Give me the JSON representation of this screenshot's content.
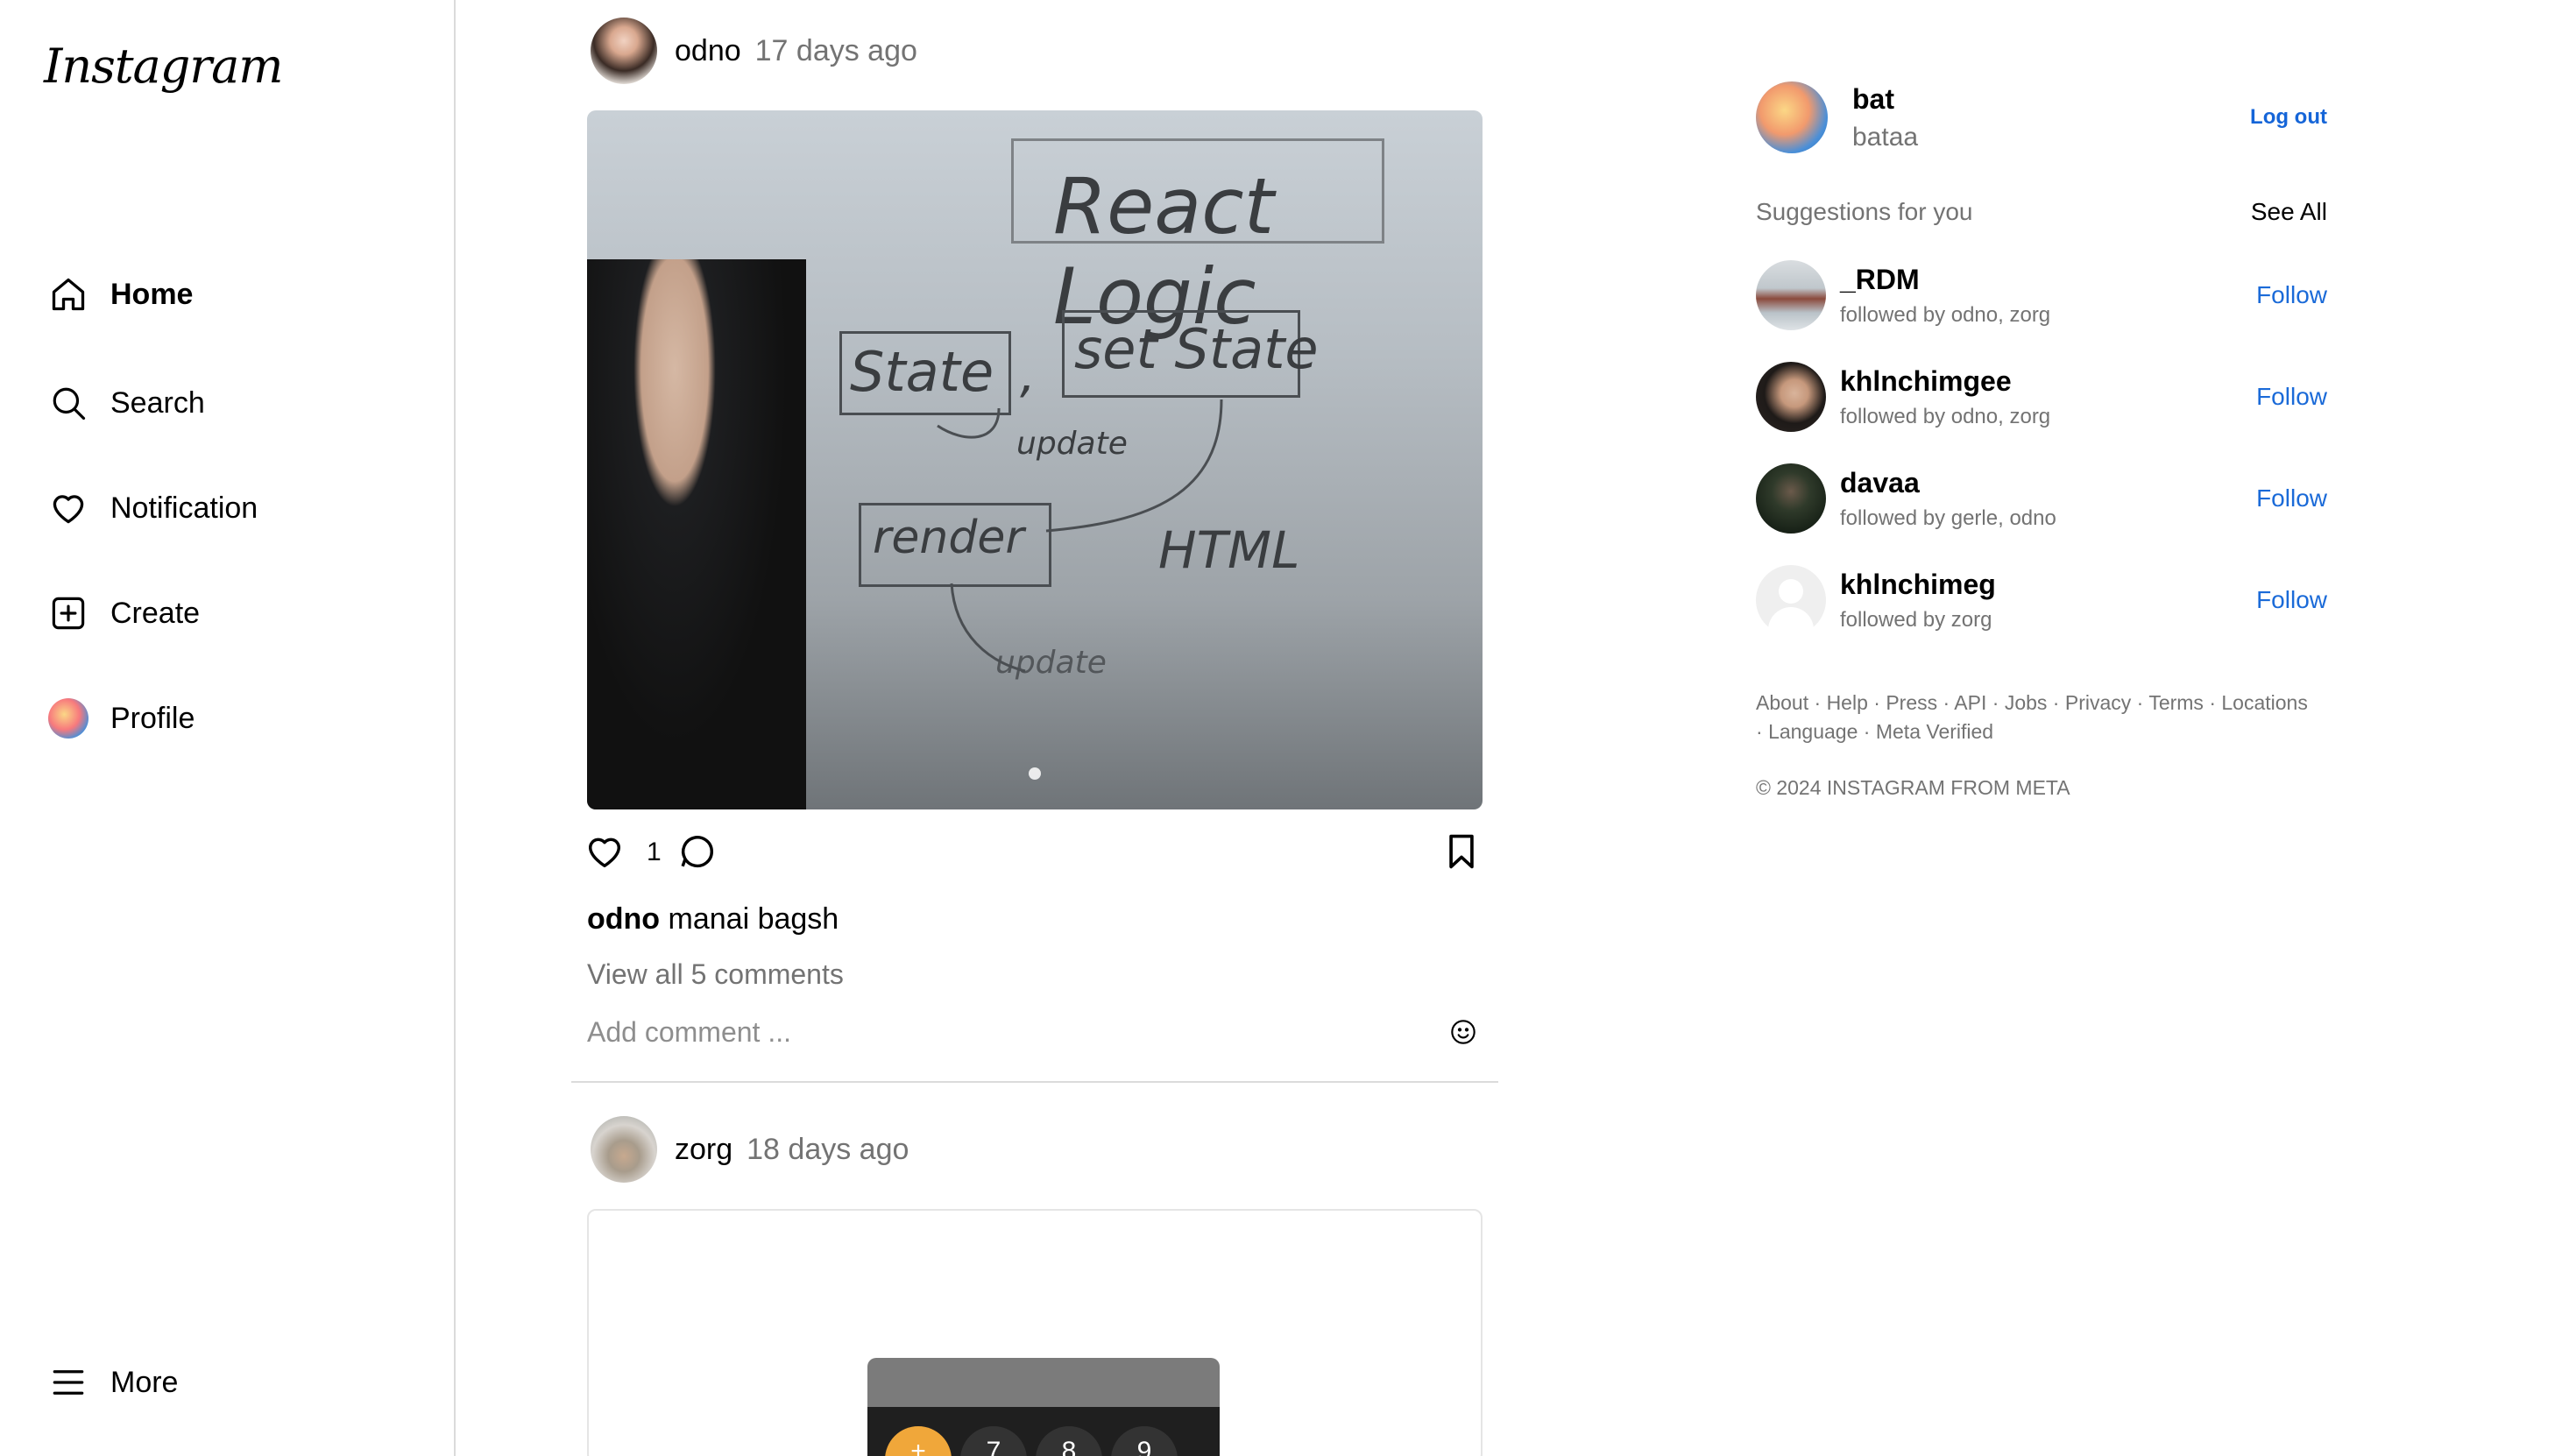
{
  "app": {
    "logo": "Instagram"
  },
  "sidebar": {
    "items": [
      {
        "label": "Home",
        "icon": "home-icon",
        "active": true
      },
      {
        "label": "Search",
        "icon": "search-icon"
      },
      {
        "label": "Notification",
        "icon": "heart-icon"
      },
      {
        "label": "Create",
        "icon": "plus-square-icon"
      },
      {
        "label": "Profile",
        "icon": "avatar"
      }
    ],
    "more_label": "More"
  },
  "feed": {
    "posts": [
      {
        "user": "odno",
        "time": "17 days ago",
        "likes": "1",
        "caption_user": "odno",
        "caption_text": "manai bagsh",
        "view_comments": "View all 5 comments",
        "comment_placeholder": "Add comment ...",
        "board": {
          "title": "React Logic",
          "state": "State",
          "comma": ",",
          "set_state": "set State",
          "update1": "update",
          "render": "render",
          "html": "HTML",
          "update2": "update"
        }
      },
      {
        "user": "zorg",
        "time": "18 days ago",
        "calc_keys": [
          "+",
          "7",
          "8",
          "9"
        ]
      }
    ]
  },
  "right": {
    "me": {
      "name": "bat",
      "handle": "bataa",
      "logout": "Log out"
    },
    "suggestions_title": "Suggestions for you",
    "see_all": "See All",
    "suggestions": [
      {
        "name": "_RDM",
        "sub": "followed by odno, zorg",
        "action": "Follow"
      },
      {
        "name": "khlnchimgee",
        "sub": "followed by odno, zorg",
        "action": "Follow"
      },
      {
        "name": "davaa",
        "sub": "followed by gerle, odno",
        "action": "Follow"
      },
      {
        "name": "khlnchimeg",
        "sub": "followed by zorg",
        "action": "Follow"
      }
    ],
    "footer_links": [
      "About",
      "Help",
      "Press",
      "API",
      "Jobs",
      "Privacy",
      "Terms",
      "Locations",
      "Language",
      "Meta Verified"
    ],
    "copyright": "© 2024 INSTAGRAM FROM META"
  },
  "colors": {
    "link": "#1a6ad8",
    "muted": "#737373",
    "border": "#dbdbdb",
    "calc_accent": "#f0a73a"
  }
}
